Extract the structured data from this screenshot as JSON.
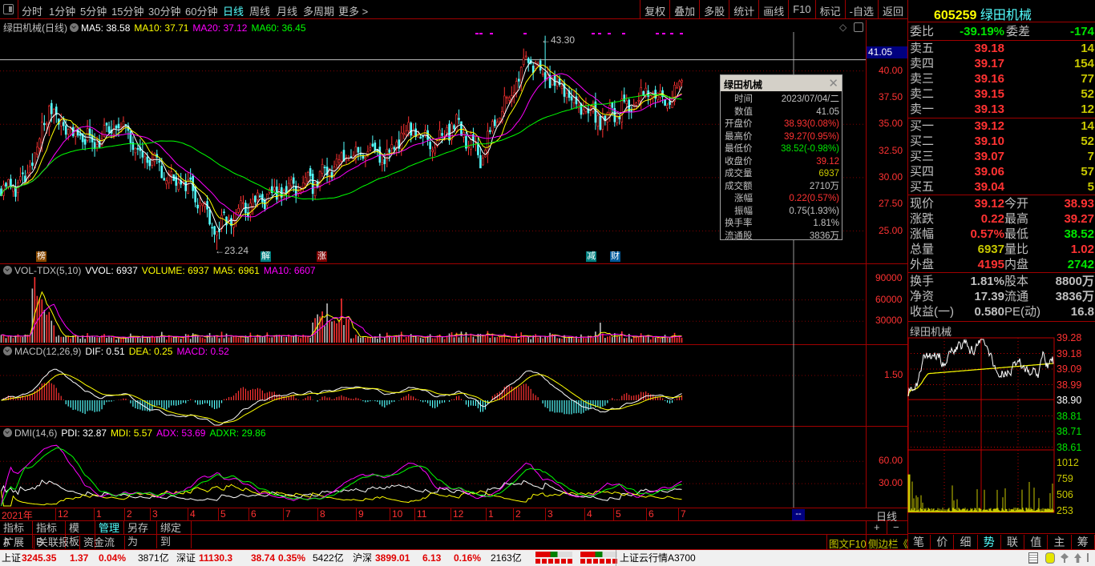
{
  "toolbar": {
    "periods": [
      "分时",
      "1分钟",
      "5分钟",
      "15分钟",
      "30分钟",
      "60分钟",
      "日线",
      "周线",
      "月线",
      "多周期",
      "更多 >"
    ],
    "active_period": "日线",
    "buttons": [
      "复权",
      "叠加",
      "多股",
      "统计",
      "画线",
      "F10",
      "标记",
      "-自选",
      "返回"
    ]
  },
  "main_chart": {
    "title": "绿田机械(日线)",
    "ma": [
      {
        "label": "MA5: 38.58",
        "color": "#ffffff"
      },
      {
        "label": "MA10: 37.71",
        "color": "#ffff00"
      },
      {
        "label": "MA20: 37.12",
        "color": "#ff00ff"
      },
      {
        "label": "MA60: 36.45",
        "color": "#00ff00"
      }
    ],
    "cursor_price": "41.05",
    "high_label": "43.30",
    "low_label": "23.24",
    "price_ticks": [
      "40.00",
      "37.50",
      "35.00",
      "32.50",
      "30.00",
      "27.50",
      "25.00"
    ],
    "markers": [
      {
        "text": "榜",
        "color": "#8b4a00"
      },
      {
        "text": "解",
        "color": "#008080"
      },
      {
        "text": "涨",
        "color": "#800000"
      },
      {
        "text": "减",
        "color": "#008080"
      },
      {
        "text": "财",
        "color": "#005a9c"
      }
    ]
  },
  "tooltip": {
    "title": "绿田机械",
    "rows": [
      {
        "label": "时间",
        "value": "2023/07/04/二",
        "color": "#c0c0c0"
      },
      {
        "label": "数值",
        "value": "41.05",
        "color": "#c0c0c0"
      },
      {
        "label": "开盘价",
        "value": "38.93(0.08%)",
        "color": "#ff3232"
      },
      {
        "label": "最高价",
        "value": "39.27(0.95%)",
        "color": "#ff3232"
      },
      {
        "label": "最低价",
        "value": "38.52(-0.98%)",
        "color": "#00e600"
      },
      {
        "label": "收盘价",
        "value": "39.12",
        "color": "#ff3232"
      },
      {
        "label": "成交量",
        "value": "6937",
        "color": "#c8c800"
      },
      {
        "label": "成交额",
        "value": "2710万",
        "color": "#c0c0c0"
      },
      {
        "label": "涨幅",
        "value": "0.22(0.57%)",
        "color": "#ff3232"
      },
      {
        "label": "振幅",
        "value": "0.75(1.93%)",
        "color": "#c0c0c0"
      },
      {
        "label": "换手率",
        "value": "1.81%",
        "color": "#c0c0c0"
      },
      {
        "label": "流通股",
        "value": "3836万",
        "color": "#c0c0c0"
      }
    ]
  },
  "vol_pane": {
    "name": "VOL-TDX(5,10)",
    "items": [
      {
        "label": "VVOL: 6937",
        "color": "#ffffff"
      },
      {
        "label": "VOLUME: 6937",
        "color": "#ffff00"
      },
      {
        "label": "MA5: 6961",
        "color": "#ffff00"
      },
      {
        "label": "MA10: 6607",
        "color": "#ff00ff"
      }
    ],
    "ticks": [
      "90000",
      "60000",
      "30000"
    ]
  },
  "macd_pane": {
    "name": "MACD(12,26,9)",
    "items": [
      {
        "label": "DIF: 0.51",
        "color": "#ffffff"
      },
      {
        "label": "DEA: 0.25",
        "color": "#ffff00"
      },
      {
        "label": "MACD: 0.52",
        "color": "#ff00ff"
      }
    ],
    "ticks": [
      "1.50"
    ]
  },
  "dmi_pane": {
    "name": "DMI(14,6)",
    "items": [
      {
        "label": "PDI: 32.87",
        "color": "#ffffff"
      },
      {
        "label": "MDI: 5.57",
        "color": "#ffff00"
      },
      {
        "label": "ADX: 53.69",
        "color": "#ff00ff"
      },
      {
        "label": "ADXR: 29.86",
        "color": "#00ff00"
      }
    ],
    "ticks": [
      "60.00",
      "30.00"
    ]
  },
  "date_axis": [
    "2021年",
    "12",
    "1",
    "2",
    "3",
    "4",
    "5",
    "6",
    "7",
    "8",
    "9",
    "10",
    "11",
    "12",
    "1",
    "2",
    "3",
    "4",
    "5",
    "6",
    "7"
  ],
  "cursor_date_box": "--",
  "period_label": "日线",
  "zoom_buttons": [
    "+",
    "−"
  ],
  "bottom_tabs_row1": [
    "指标A",
    "指标B",
    "模 板",
    "管理",
    "另存为",
    "绑定到"
  ],
  "bottom_tabs_row1_active": "管理",
  "bottom_tabs_row2": [
    "扩展∧",
    "关联报价",
    "资金流向"
  ],
  "sidebar_links": [
    "图文F10",
    "侧边栏《"
  ],
  "right_panel": {
    "code": "605259",
    "name": "绿田机械",
    "weibi": {
      "label": "委比",
      "value": "-39.19%",
      "label2": "委差",
      "value2": "-174"
    },
    "sells": [
      {
        "label": "卖五",
        "price": "39.18",
        "vol": "14"
      },
      {
        "label": "卖四",
        "price": "39.17",
        "vol": "154"
      },
      {
        "label": "卖三",
        "price": "39.16",
        "vol": "77"
      },
      {
        "label": "卖二",
        "price": "39.15",
        "vol": "52"
      },
      {
        "label": "卖一",
        "price": "39.13",
        "vol": "12"
      }
    ],
    "buys": [
      {
        "label": "买一",
        "price": "39.12",
        "vol": "14"
      },
      {
        "label": "买二",
        "price": "39.10",
        "vol": "52"
      },
      {
        "label": "买三",
        "price": "39.07",
        "vol": "7"
      },
      {
        "label": "买四",
        "price": "39.06",
        "vol": "57"
      },
      {
        "label": "买五",
        "price": "39.04",
        "vol": "5"
      }
    ],
    "quotes": [
      {
        "l1": "现价",
        "v1": "39.12",
        "c1": "red",
        "l2": "今开",
        "v2": "38.93",
        "c2": "red"
      },
      {
        "l1": "涨跌",
        "v1": "0.22",
        "c1": "red",
        "l2": "最高",
        "v2": "39.27",
        "c2": "red"
      },
      {
        "l1": "涨幅",
        "v1": "0.57%",
        "c1": "red",
        "l2": "最低",
        "v2": "38.52",
        "c2": "grn"
      },
      {
        "l1": "总量",
        "v1": "6937",
        "c1": "yel",
        "l2": "量比",
        "v2": "1.02",
        "c2": "red"
      },
      {
        "l1": "外盘",
        "v1": "4195",
        "c1": "red",
        "l2": "内盘",
        "v2": "2742",
        "c2": "grn"
      }
    ],
    "stats": [
      {
        "l1": "换手",
        "v1": "1.81%",
        "l2": "股本",
        "v2": "8800万"
      },
      {
        "l1": "净资",
        "v1": "17.39",
        "l2": "流通",
        "v2": "3836万"
      },
      {
        "l1": "收益(一)",
        "v1": "0.580",
        "l2": "PE(动)",
        "v2": "16.8"
      }
    ],
    "mini_title": "绿田机械",
    "mini_price_ticks": [
      {
        "v": "39.28",
        "c": "#ff3232"
      },
      {
        "v": "39.18",
        "c": "#ff3232"
      },
      {
        "v": "39.09",
        "c": "#ff3232"
      },
      {
        "v": "38.99",
        "c": "#ff3232"
      },
      {
        "v": "38.90",
        "c": "#ffffff"
      },
      {
        "v": "38.81",
        "c": "#00e600"
      },
      {
        "v": "38.71",
        "c": "#00e600"
      },
      {
        "v": "38.61",
        "c": "#00e600"
      }
    ],
    "mini_vol_ticks": [
      "1012",
      "759",
      "506",
      "253"
    ],
    "tabs": [
      "笔",
      "价",
      "细",
      "势",
      "联",
      "值",
      "主",
      "筹"
    ],
    "active_tab": "势"
  },
  "status_bar": {
    "items": [
      {
        "name": "上证",
        "price": "3245.35",
        "chg": "1.37",
        "pct": "0.04%",
        "amt": "3871亿"
      },
      {
        "name": "深证",
        "price": "11130.3",
        "chg": "38.74",
        "pct": "0.35%",
        "amt": "5422亿"
      },
      {
        "name": "沪深",
        "price": "3899.01",
        "chg": "6.13",
        "pct": "0.16%",
        "amt": "2163亿"
      }
    ],
    "server": "上证云行情A3700"
  },
  "chart_data": {
    "type": "candlestick",
    "period": "daily",
    "close_trend": [
      29.0,
      29.5,
      36.5,
      34.0,
      33.5,
      35.0,
      32.0,
      30.0,
      29.0,
      25.0,
      27.0,
      28.0,
      29.0,
      29.5,
      31.5,
      32.5,
      32.0,
      34.5,
      33.5,
      35.0,
      32.0,
      37.0,
      41.0,
      39.0,
      37.0,
      35.5,
      36.5,
      38.0,
      37.0
    ],
    "period_high": 43.3,
    "period_low": 23.24,
    "last_bar": {
      "date": "2023/07/04",
      "open": 38.93,
      "high": 39.27,
      "low": 38.52,
      "close": 39.12,
      "volume": 6937
    },
    "price_range": [
      23,
      44
    ],
    "ma_colors": {
      "ma5": "#ffffff",
      "ma10": "#ffff00",
      "ma20": "#ff00ff",
      "ma60": "#00ff00"
    },
    "up_color": "#ff3232",
    "down_color": "#54ffff",
    "intraday": {
      "prev_close": 38.9,
      "open": 38.93,
      "high": 39.27,
      "low": 38.52,
      "last": 39.12,
      "range": [
        38.61,
        39.28
      ],
      "vol_max": 1012
    }
  }
}
